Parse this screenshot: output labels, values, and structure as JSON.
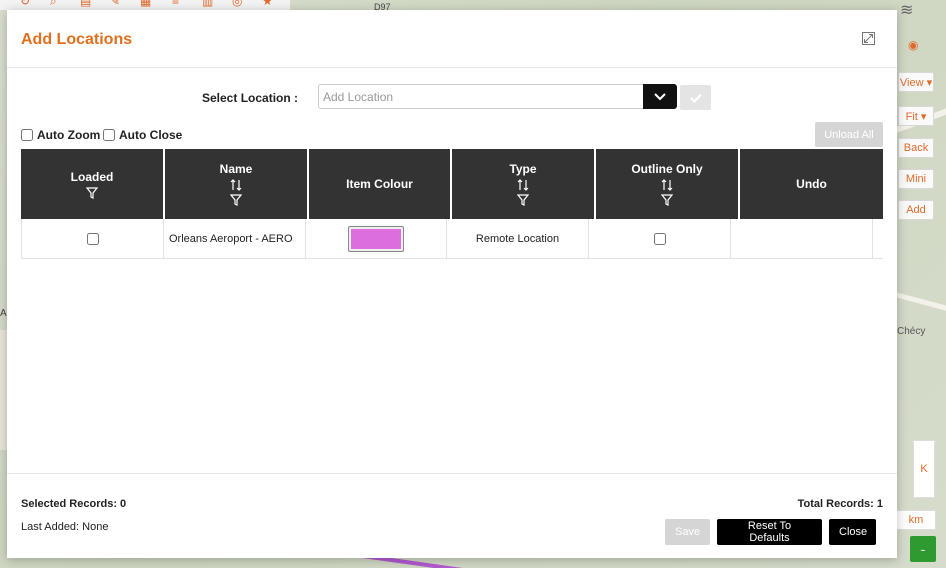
{
  "modal": {
    "title": "Add Locations"
  },
  "location_select": {
    "label": "Select Location :",
    "placeholder": "Add Location"
  },
  "options": {
    "auto_zoom_label": "Auto Zoom",
    "auto_zoom_checked": false,
    "auto_close_label": "Auto Close",
    "auto_close_checked": false,
    "unload_all_label": "Unload All"
  },
  "table": {
    "columns": [
      "Loaded",
      "Name",
      "Item Colour",
      "Type",
      "Outline Only",
      "Undo"
    ],
    "rows": [
      {
        "loaded": false,
        "name": "Orleans Aeroport - AERO",
        "item_colour": "#dd6edd",
        "type": "Remote Location",
        "outline_only": false,
        "undo": ""
      }
    ]
  },
  "footer": {
    "selected_records": "Selected Records: 0",
    "last_added": "Last Added: None",
    "total_records": "Total Records: 1",
    "save_label": "Save",
    "reset_label": "Reset To Defaults",
    "close_label": "Close"
  },
  "map": {
    "label_top": "D97",
    "label_checy": "Chécy",
    "label_a": "A",
    "buttons": [
      "View ▾",
      "Fit ▾",
      "Back",
      "Mini",
      "Add"
    ],
    "k_label": "K",
    "km_label": "km",
    "minus_label": "-"
  },
  "colors": {
    "accent": "#e0701f",
    "header_dark": "#333333",
    "primary_button": "#000000",
    "disabled_button": "#d5d5d5"
  }
}
